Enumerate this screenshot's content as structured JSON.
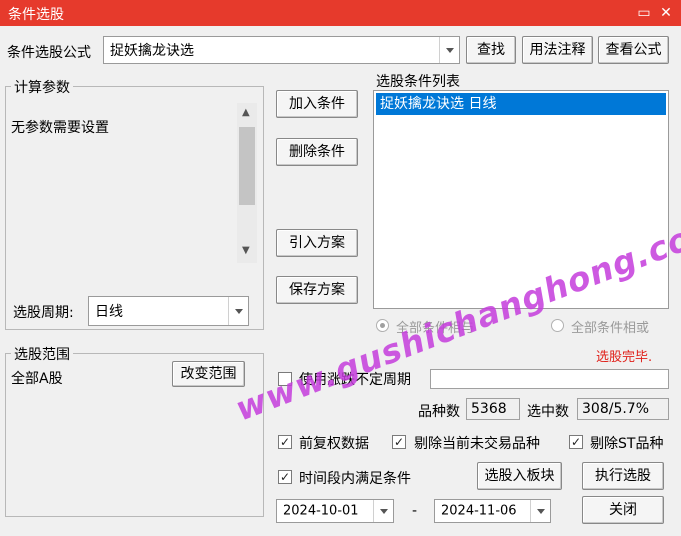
{
  "window": {
    "title": "条件选股",
    "minimize_glyph": "▭",
    "close_glyph": "✕"
  },
  "formula": {
    "label": "条件选股公式",
    "value": "捉妖擒龙诀选"
  },
  "top_buttons": {
    "search": "查找",
    "usage": "用法注释",
    "view": "查看公式"
  },
  "params": {
    "title": "计算参数",
    "text": "无参数需要设置"
  },
  "period": {
    "label": "选股周期:",
    "value": "日线"
  },
  "mid_buttons": {
    "add": "加入条件",
    "delete": "删除条件",
    "import": "引入方案",
    "save": "保存方案"
  },
  "condition_list": {
    "title": "选股条件列表",
    "items": [
      "捉妖擒龙诀选  日线"
    ]
  },
  "logic": {
    "and_label": "全部条件相与",
    "or_label": "全部条件相或",
    "selected": "and"
  },
  "status": {
    "text": "选股完毕.",
    "color": "#e0201a"
  },
  "range": {
    "title": "选股范围",
    "value": "全部A股",
    "change_button": "改变范围"
  },
  "uncertain_period": {
    "label": "使用涨跌不定周期",
    "checked": false
  },
  "counts": {
    "total_label": "品种数",
    "total_value": "5368",
    "selected_label": "选中数",
    "selected_value": "308/5.7%"
  },
  "options": {
    "pre_adjust": {
      "label": "前复权数据",
      "checked": true
    },
    "remove_untraded": {
      "label": "剔除当前未交易品种",
      "checked": true
    },
    "remove_st": {
      "label": "剔除ST品种",
      "checked": true
    },
    "time_range": {
      "label": "时间段内满足条件",
      "checked": true
    }
  },
  "bottom_buttons": {
    "to_block": "选股入板块",
    "execute": "执行选股",
    "close": "关闭"
  },
  "dates": {
    "start": "2024-10-01",
    "separator": "-",
    "end": "2024-11-06"
  },
  "watermark": "www.gushichanghong.com",
  "icons": {
    "up": "▲",
    "down": "▼",
    "check": "✓"
  },
  "colors": {
    "titlebar": "#e63a2c",
    "selection": "#0078d7",
    "watermark": "#c43cdc"
  }
}
